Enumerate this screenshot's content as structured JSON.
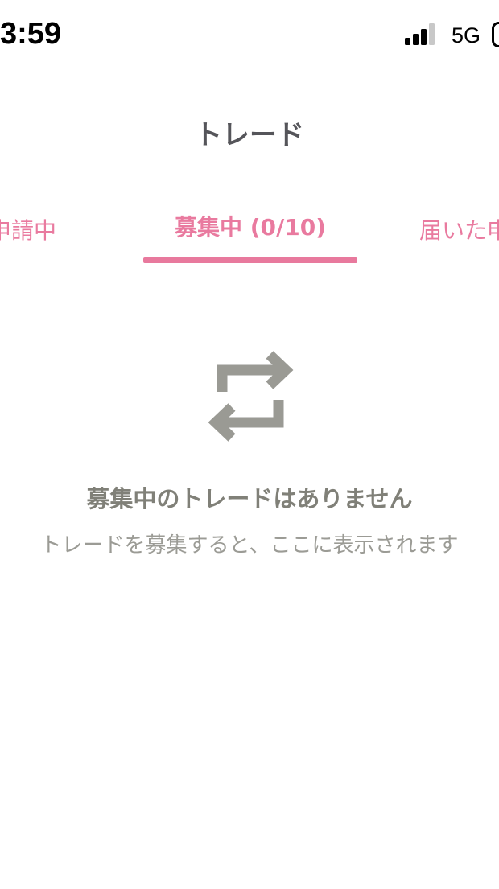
{
  "status_bar": {
    "time": "3:59",
    "network": "5G"
  },
  "header": {
    "title": "トレード"
  },
  "tabs": [
    {
      "label": "申請中"
    },
    {
      "label": "募集中 (0/10)"
    },
    {
      "label": "届いた申"
    }
  ],
  "empty_state": {
    "icon": "repeat-arrows-icon",
    "title": "募集中のトレードはありません",
    "description": "トレードを募集すると、ここに表示されます"
  },
  "colors": {
    "accent": "#e8799d",
    "icon_gray": "#9a9a94",
    "title_gray": "#55555a"
  }
}
